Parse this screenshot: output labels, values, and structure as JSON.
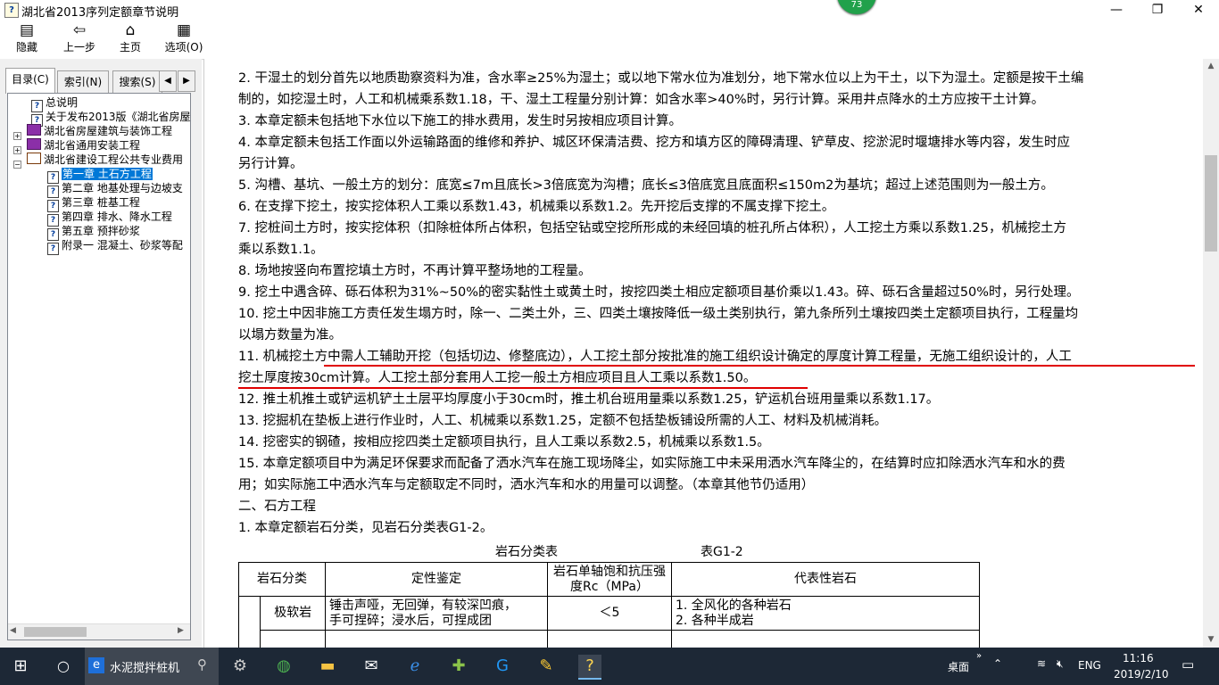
{
  "window": {
    "title": "湖北省2013序列定额章节说明",
    "app_icon": "help-book-icon",
    "badge_count": "73",
    "controls": [
      "minimize-icon",
      "restore-icon",
      "close-icon"
    ]
  },
  "toolbar": [
    {
      "label": "隐藏",
      "icon": "hide-pane-icon"
    },
    {
      "label": "上一步",
      "icon": "back-arrow-icon"
    },
    {
      "label": "主页",
      "icon": "home-icon"
    },
    {
      "label": "选项(O)",
      "icon": "options-icon"
    }
  ],
  "tabs": [
    {
      "label": "目录(C)",
      "active": true
    },
    {
      "label": "索引(N)",
      "active": false
    },
    {
      "label": "搜索(S)",
      "active": false
    }
  ],
  "tree": [
    {
      "label": "总说明",
      "icon": "help-page-icon",
      "level": 1,
      "expander": ""
    },
    {
      "label": "关于发布2013版《湖北省房屋",
      "icon": "help-page-icon",
      "level": 1,
      "expander": ""
    },
    {
      "label": "湖北省房屋建筑与装饰工程",
      "icon": "book-icon",
      "level": 0,
      "expander": "+"
    },
    {
      "label": "湖北省通用安装工程",
      "icon": "book-icon",
      "level": 0,
      "expander": "+"
    },
    {
      "label": "湖北省建设工程公共专业费用",
      "icon": "book-open-icon",
      "level": 0,
      "expander": "−"
    },
    {
      "label": "第一章 土石方工程",
      "icon": "help-page-icon",
      "level": 2,
      "expander": "",
      "selected": true
    },
    {
      "label": "第二章 地基处理与边坡支",
      "icon": "help-page-icon",
      "level": 2,
      "expander": ""
    },
    {
      "label": "第三章 桩基工程",
      "icon": "help-page-icon",
      "level": 2,
      "expander": ""
    },
    {
      "label": "第四章 排水、降水工程",
      "icon": "help-page-icon",
      "level": 2,
      "expander": ""
    },
    {
      "label": "第五章 预拌砂浆",
      "icon": "help-page-icon",
      "level": 2,
      "expander": ""
    },
    {
      "label": "附录一 混凝土、砂浆等配",
      "icon": "help-page-icon",
      "level": 2,
      "expander": ""
    }
  ],
  "content": {
    "lines": [
      "2. 干湿土的划分首先以地质勘察资料为准，含水率≥25%为湿土；或以地下常水位为准划分，地下常水位以上为干土，以下为湿土。定额是按干土编",
      "制的，如挖湿土时，人工和机械乘系数1.18，干、湿土工程量分别计算：如含水率>40%时，另行计算。采用井点降水的土方应按干土计算。",
      "3. 本章定额未包括地下水位以下施工的排水费用，发生时另按相应项目计算。",
      "4. 本章定额未包括工作面以外运输路面的维修和养护、城区环保清洁费、挖方和填方区的障碍清理、铲草皮、挖淤泥时堰塘排水等内容，发生时应",
      "另行计算。",
      "5. 沟槽、基坑、一般土方的划分：底宽≤7m且底长>3倍底宽为沟槽；底长≤3倍底宽且底面积≤150m2为基坑；超过上述范围则为一般土方。",
      "6. 在支撑下挖土，按实挖体积人工乘以系数1.43，机械乘以系数1.2。先开挖后支撑的不属支撑下挖土。",
      "7. 挖桩间土方时，按实挖体积（扣除桩体所占体积，包括空钻或空挖所形成的未经回填的桩孔所占体积），人工挖土方乘以系数1.25，机械挖土方",
      "乘以系数1.1。",
      "8. 场地按竖向布置挖填土方时，不再计算平整场地的工程量。",
      "9. 挖土中遇含碎、砾石体积为31%~50%的密实黏性土或黄土时，按挖四类土相应定额项目基价乘以1.43。碎、砾石含量超过50%时，另行处理。",
      "10. 挖土中因非施工方责任发生塌方时，除一、二类土外，三、四类土壤按降低一级土类别执行，第九条所列土壤按四类土定额项目执行，工程量均",
      "以塌方数量为准。",
      "11. 机械挖土方中需人工辅助开挖（包括切边、修整底边），人工挖土部分按批准的施工组织设计确定的厚度计算工程量，无施工组织设计的，人工",
      "挖土厚度按30cm计算。人工挖土部分套用人工挖一般土方相应项目且人工乘以系数1.50。",
      "12. 推土机推土或铲运机铲土土层平均厚度小于30cm时，推土机台班用量乘以系数1.25，铲运机台班用量乘以系数1.17。",
      "13. 挖掘机在垫板上进行作业时，人工、机械乘以系数1.25，定额不包括垫板铺设所需的人工、材料及机械消耗。",
      "14. 挖密实的钢碴，按相应挖四类土定额项目执行，且人工乘以系数2.5，机械乘以系数1.5。",
      "15. 本章定额项目中为满足环保要求而配备了洒水汽车在施工现场降尘，如实际施工中未采用洒水汽车降尘的，在结算时应扣除洒水汽车和水的费",
      "用；如实际施工中洒水汽车与定额取定不同时，洒水汽车和水的用量可以调整。（本章其他节仍适用）",
      "二、石方工程",
      "1. 本章定额岩石分类，见岩石分类表G1-2。"
    ],
    "table_caption": "岩石分类表",
    "table_code": "表G1-2",
    "table_headers": [
      "岩石分类",
      "定性鉴定",
      "岩石单轴饱和抗压强度Rc（MPa）",
      "代表性岩石"
    ],
    "table_rows": [
      {
        "group": "",
        "name": "极软岩",
        "qualitative": [
          "锤击声哑，无回弹，有较深凹痕，",
          "手可捏碎；浸水后，可捏成团"
        ],
        "strength": "＜5",
        "rocks": [
          "1. 全风化的各种岩石",
          "2. 各种半成岩"
        ]
      }
    ],
    "annotation_color": "#e00000"
  },
  "taskbar": {
    "search_text": "水泥搅拌桩机",
    "pinned": [
      "settings-icon",
      "browser-icon",
      "explorer-icon",
      "mail-icon",
      "edge-icon",
      "plus-app-icon",
      "g-app-icon",
      "notes-icon",
      "help-app-icon"
    ],
    "tray_desktop": "桌面",
    "tray_lang": "ENG",
    "time": "11:16",
    "date": "2019/2/10"
  },
  "colors": {
    "selection": "#0078d7",
    "taskbar": "#1d2836",
    "badge": "#21a14b"
  }
}
